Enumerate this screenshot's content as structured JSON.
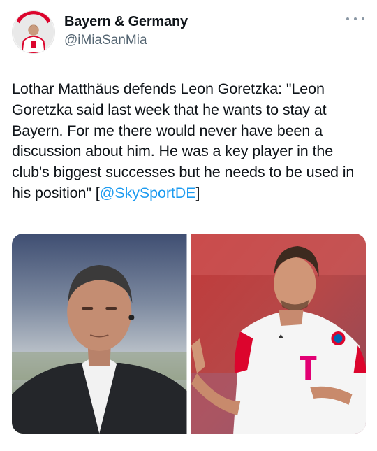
{
  "author": {
    "display_name": "Bayern & Germany",
    "handle": "@iMiaSanMia",
    "avatar_icon": "bayern-player-avatar"
  },
  "menu": {
    "icon": "more-options-icon"
  },
  "tweet": {
    "text": "Lothar Matthäus defends Leon Goretzka: \"Leon Goretzka said last week that he wants to stay at Bayern. For me there would never have been a discussion about him. He was a key player in the club's biggest successes but he needs to be used in his position\" [",
    "mention": "@SkySportDE",
    "text_end": "]"
  },
  "media": {
    "photos": [
      {
        "subject": "man-in-suit-with-earpiece"
      },
      {
        "subject": "footballer-in-red-white-kit"
      }
    ]
  },
  "colors": {
    "mention": "#1d9bf0",
    "secondary_text": "#536471",
    "bayern_red": "#dc052d"
  }
}
